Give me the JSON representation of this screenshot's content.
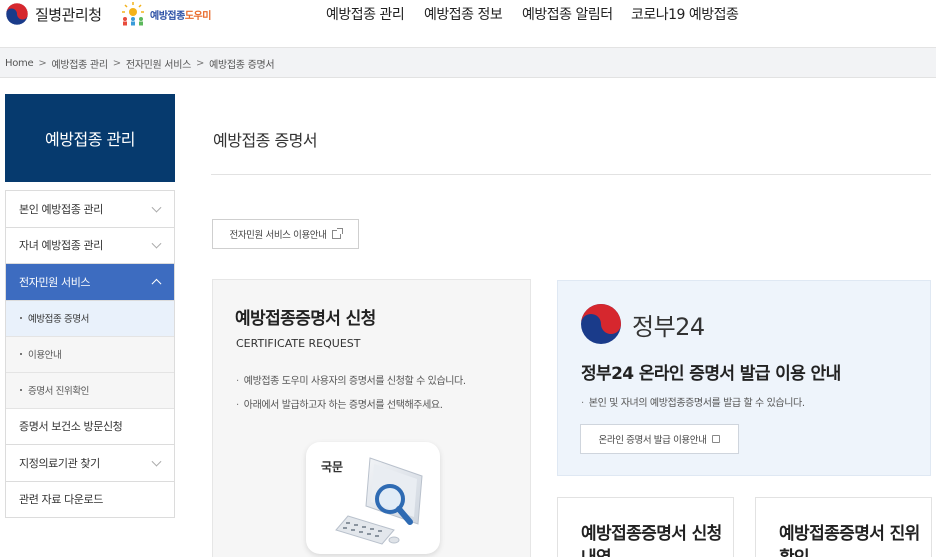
{
  "header": {
    "org_name": "질병관리청",
    "helper_logo_a": "예방접종",
    "helper_logo_b": "도우미",
    "nav": [
      "예방접종 관리",
      "예방접종 정보",
      "예방접종 알림터",
      "코로나19 예방접종"
    ]
  },
  "breadcrumb": [
    "Home",
    "예방접종 관리",
    "전자민원 서비스",
    "예방접종 증명서"
  ],
  "sidebar": {
    "title": "예방접종 관리",
    "items": [
      {
        "label": "본인 예방접종 관리"
      },
      {
        "label": "자녀 예방접종 관리"
      },
      {
        "label": "전자민원 서비스"
      },
      {
        "label": "예방접종 증명서"
      },
      {
        "label": "이용안내"
      },
      {
        "label": "증명서 진위확인"
      },
      {
        "label": "증명서 보건소 방문신청"
      },
      {
        "label": "지정의료기관 찾기"
      },
      {
        "label": "관련 자료 다운로드"
      }
    ]
  },
  "main": {
    "page_title": "예방접종 증명서",
    "guide_button": "전자민원 서비스 이용안내",
    "request_card": {
      "title": "예방접종증명서 신청",
      "subtitle": "CERTIFICATE REQUEST",
      "bullets": [
        "예방접종 도우미 사용자의 증명서를 신청할 수 있습니다.",
        "아래에서 발급하고자 하는 증명서를 선택해주세요."
      ],
      "icon_label": "국문"
    },
    "gov24_card": {
      "logo_text": "정부24",
      "title": "정부24 온라인 증명서 발급 이용 안내",
      "bullet": "본인 및 자녀의 예방접종증명서를 발급 할 수 있습니다.",
      "button": "온라인 증명서 발급 이용안내"
    },
    "small_cards": [
      {
        "title": "예방접종증명서 신청내역"
      },
      {
        "title": "예방접종증명서 진위확인"
      }
    ]
  },
  "colors": {
    "sidebar_title_bg": "#063a6e",
    "sidebar_active_bg": "#3d6cc0",
    "gov24_card_bg": "#eef4fb"
  }
}
